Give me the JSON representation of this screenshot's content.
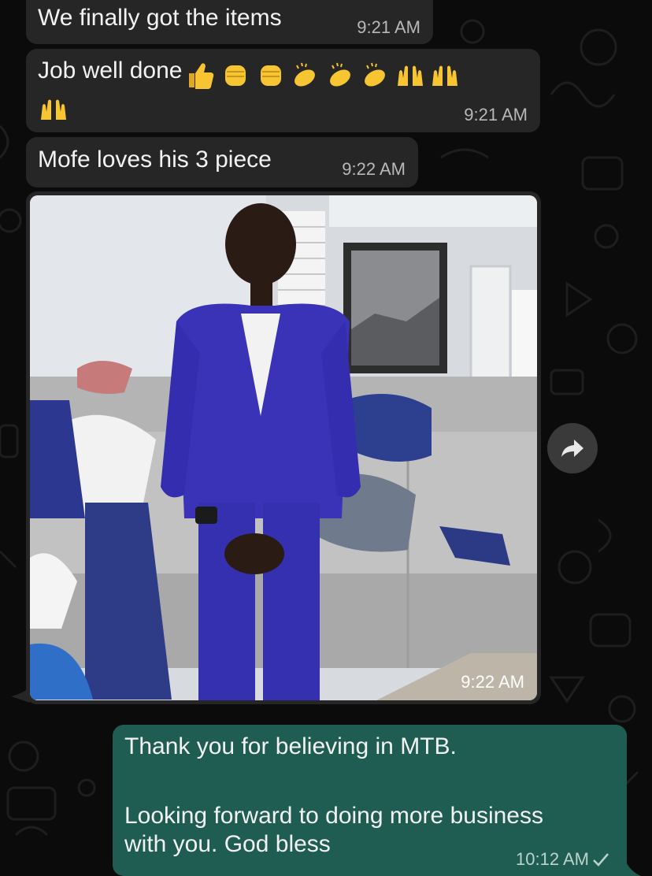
{
  "messages": [
    {
      "text": "We finally got the items",
      "time": "9:21 AM"
    },
    {
      "text": "Job well done",
      "time": "9:21 AM",
      "emojis": [
        "thumbs-up",
        "raised-fist",
        "raised-fist",
        "clapping-hands",
        "clapping-hands",
        "clapping-hands",
        "raising-hands",
        "raising-hands",
        "raising-hands"
      ]
    },
    {
      "text": "Mofe loves his 3 piece",
      "time": "9:22 AM"
    }
  ],
  "photo_message": {
    "time": "9:22 AM"
  },
  "reply": {
    "line1": "Thank you for believing in MTB.",
    "line2": "Looking forward to doing more business\nwith you. God bless",
    "time": "10:12 AM",
    "status_icon": "single-check-icon"
  },
  "colors": {
    "incoming_bubble": "#262626",
    "outgoing_bubble": "#1f5c52",
    "background": "#0b0b0b"
  }
}
